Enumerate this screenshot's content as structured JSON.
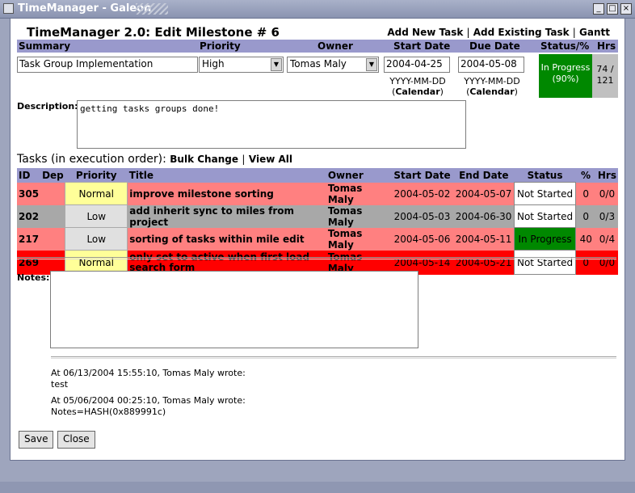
{
  "window": {
    "title": "TimeManager - Galeon",
    "buttons": {
      "minimize": "_",
      "maximize": "□",
      "close": "×"
    }
  },
  "header": {
    "title": "TimeManager 2.0: Edit Milestone # 6",
    "links": [
      "Add New Task",
      "Add Existing Task",
      "Gantt"
    ],
    "separator": "|"
  },
  "columns": {
    "summary": "Summary",
    "priority": "Priority",
    "owner": "Owner",
    "start_date": "Start Date",
    "due_date": "Due Date",
    "status": "Status/%",
    "hrs": "Hrs"
  },
  "milestone": {
    "summary_value": "Task Group Implementation",
    "priority_value": "High",
    "owner_value": "Tomas Maly",
    "start_date_value": "2004-04-25",
    "due_date_value": "2004-05-08",
    "date_format": "YYYY-MM-DD",
    "calendar_open": "(",
    "calendar_label": "Calendar",
    "calendar_close": ")",
    "status_text": "In Progress",
    "status_pct": "(90%)",
    "hrs_line1": "74 /",
    "hrs_line2": "121",
    "status_color": "#008800"
  },
  "description": {
    "label": "Description:",
    "value": "getting tasks groups done!"
  },
  "tasks": {
    "heading": "Tasks (in execution order):",
    "bulk_change": "Bulk Change",
    "separator": "|",
    "view_all": "View All",
    "headers": [
      "ID",
      "Dep",
      "Priority",
      "Title",
      "Owner",
      "Start Date",
      "End Date",
      "Status",
      "%",
      "Hrs"
    ],
    "rows": [
      {
        "id": "305",
        "dep": "",
        "priority": "Normal",
        "title": "improve milestone sorting",
        "owner": "Tomas Maly",
        "start": "2004-05-02",
        "end": "2004-05-07",
        "status": "Not Started",
        "pct": "0",
        "hrs": "0/0"
      },
      {
        "id": "202",
        "dep": "",
        "priority": "Low",
        "title": "add inherit sync to miles from project",
        "owner": "Tomas Maly",
        "start": "2004-05-03",
        "end": "2004-06-30",
        "status": "Not Started",
        "pct": "0",
        "hrs": "0/3"
      },
      {
        "id": "217",
        "dep": "",
        "priority": "Low",
        "title": "sorting of tasks within mile edit",
        "owner": "Tomas Maly",
        "start": "2004-05-06",
        "end": "2004-05-11",
        "status": "In Progress",
        "pct": "40",
        "hrs": "0/4"
      },
      {
        "id": "269",
        "dep": "",
        "priority": "Normal",
        "title": "only set to active when first load search form",
        "owner": "Tomas Maly",
        "start": "2004-05-14",
        "end": "2004-05-21",
        "status": "Not Started",
        "pct": "0",
        "hrs": "0/0"
      }
    ],
    "colors": {
      "late": "#ff8080",
      "gray": "#a8a8a8",
      "overdue": "#ff0000",
      "normal_priority": "#ffff99",
      "low_priority": "#e0e0e0",
      "in_progress": "#008800"
    }
  },
  "notes": {
    "label": "Notes:",
    "value": "",
    "history": [
      {
        "header": "At 06/13/2004 15:55:10, Tomas Maly wrote:",
        "body": "test"
      },
      {
        "header": "At 05/06/2004 00:25:10, Tomas Maly wrote:",
        "body": "Notes=HASH(0x889991c)"
      }
    ]
  },
  "buttons": {
    "save": "Save",
    "close": "Close"
  }
}
